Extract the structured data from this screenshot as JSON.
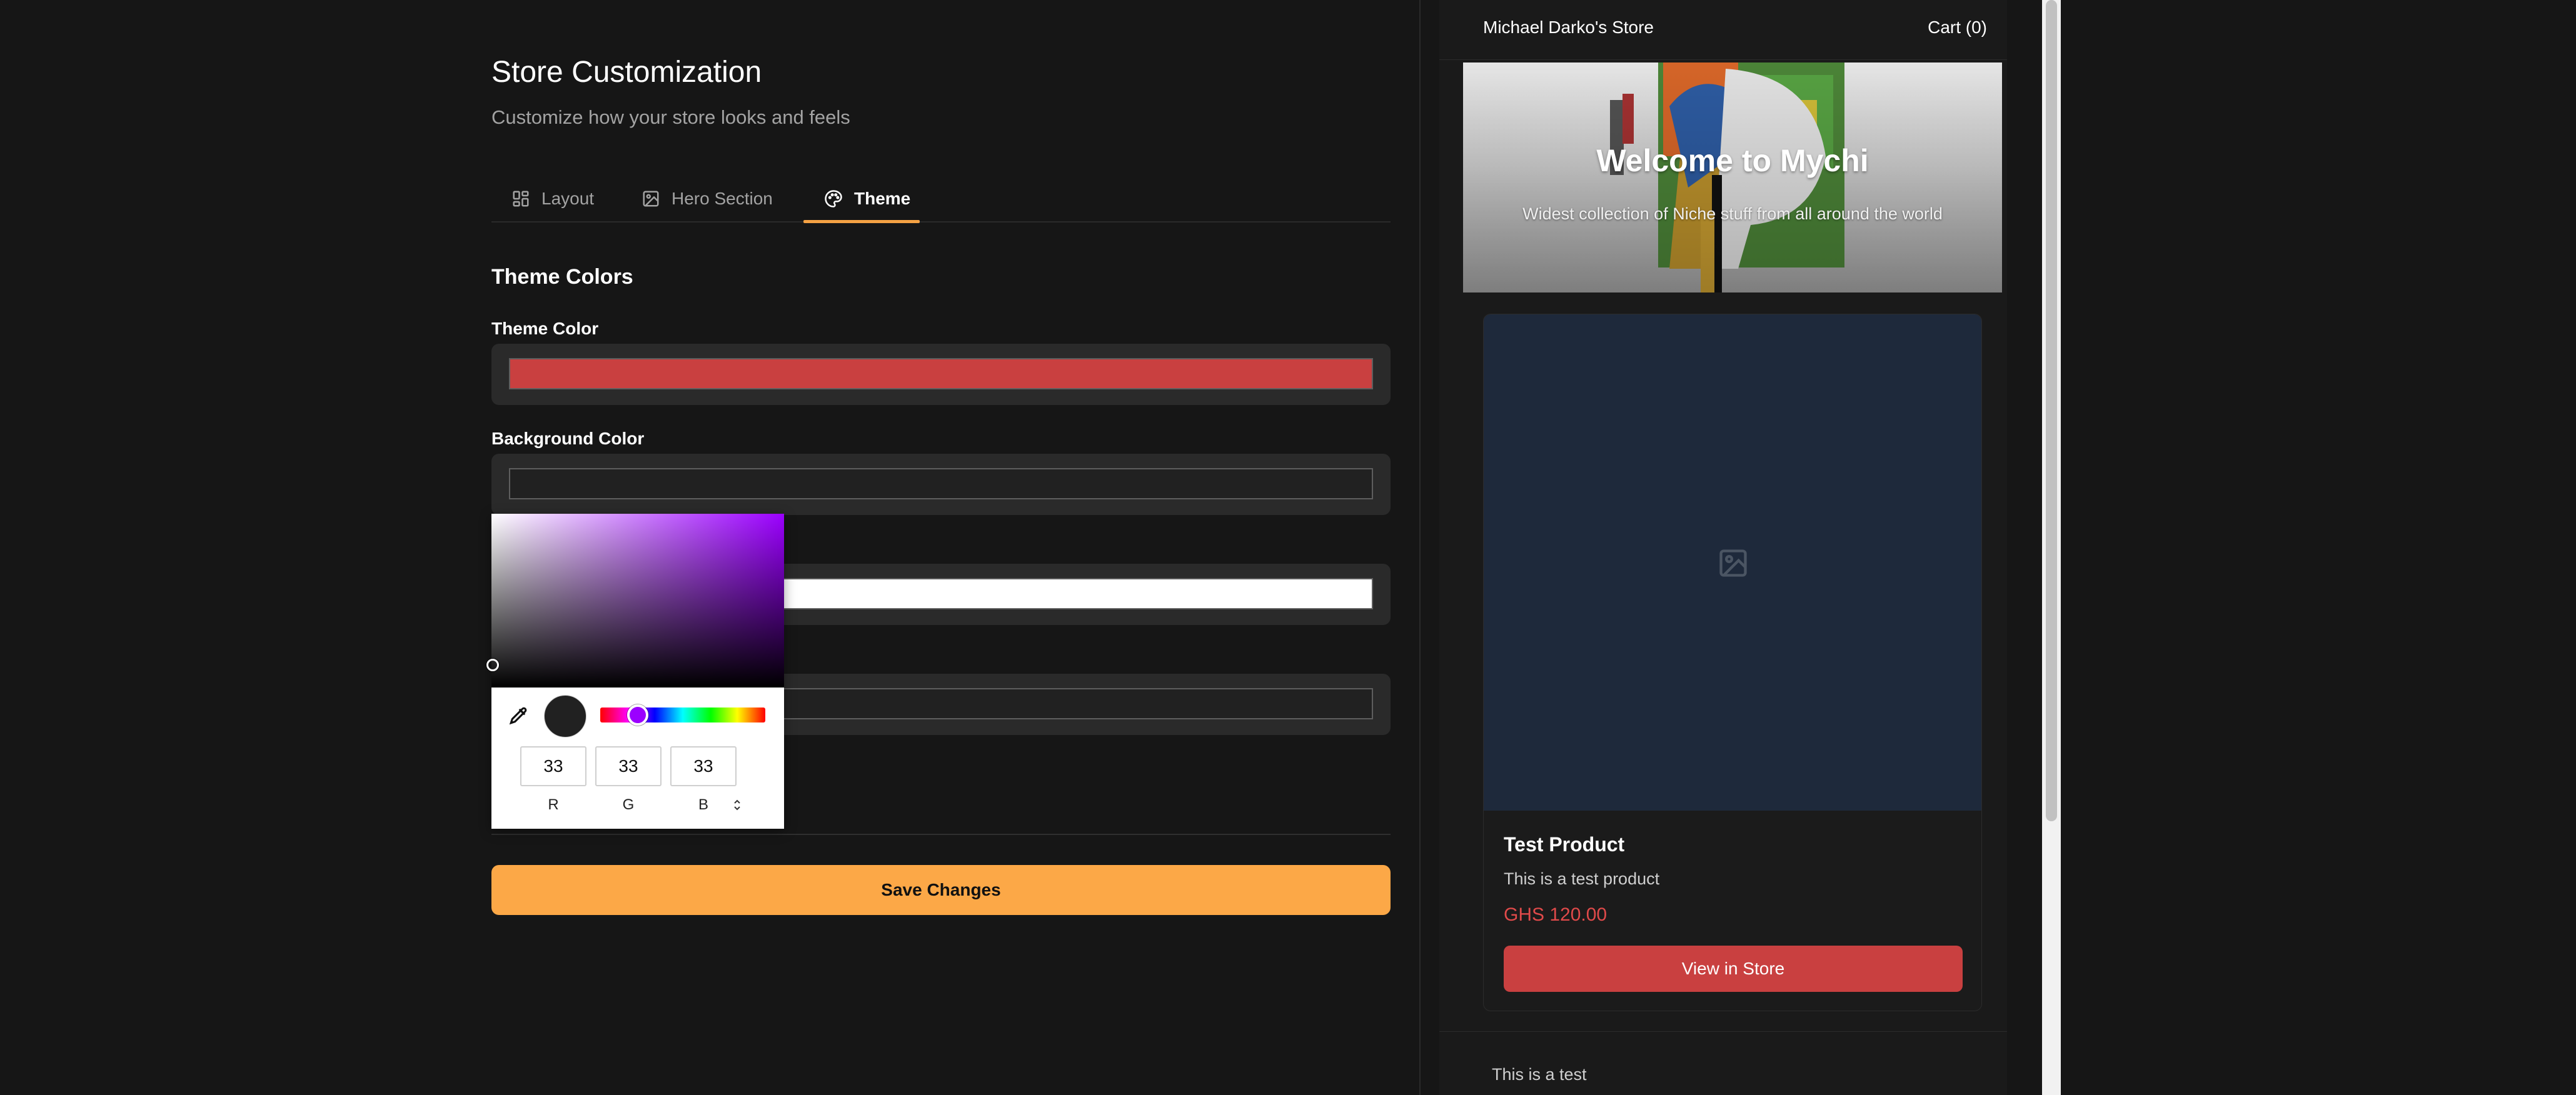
{
  "editor": {
    "title": "Store Customization",
    "subtitle": "Customize how your store looks and feels",
    "tabs": [
      {
        "label": "Layout",
        "icon": "grid-icon",
        "active": false
      },
      {
        "label": "Hero Section",
        "icon": "image-icon",
        "active": false
      },
      {
        "label": "Theme",
        "icon": "palette-icon",
        "active": true
      }
    ],
    "section_title": "Theme Colors",
    "fields": [
      {
        "label": "Theme Color",
        "value": "#c94040"
      },
      {
        "label": "Background Color",
        "value": "#212121"
      },
      {
        "label": "",
        "value": "#ffffff"
      },
      {
        "label": "",
        "value": "#212121"
      }
    ],
    "save_label": "Save Changes"
  },
  "color_picker": {
    "hue_color": "#9b00ff",
    "preview_color": "#212121",
    "r": "33",
    "g": "33",
    "b": "33",
    "r_label": "R",
    "g_label": "G",
    "b_label": "B",
    "eyedropper_icon": "eyedropper-icon",
    "mode_icon": "updown-chevron-icon"
  },
  "preview": {
    "store_name": "Michael Darko's Store",
    "cart": "Cart (0)",
    "hero_title": "Welcome to Mychi",
    "hero_subtitle": "Widest collection of Niche stuff from all around the world",
    "product": {
      "name": "Test Product",
      "description": "This is a test product",
      "price": "GHS 120.00",
      "button": "View in Store",
      "placeholder_icon": "image-placeholder-icon"
    },
    "footer_text": "This is a test"
  },
  "colors": {
    "accent": "#f5a244",
    "save_button": "#fca847",
    "theme": "#c94040",
    "price": "#e04a4a",
    "image_placeholder_bg": "#1e293b"
  }
}
